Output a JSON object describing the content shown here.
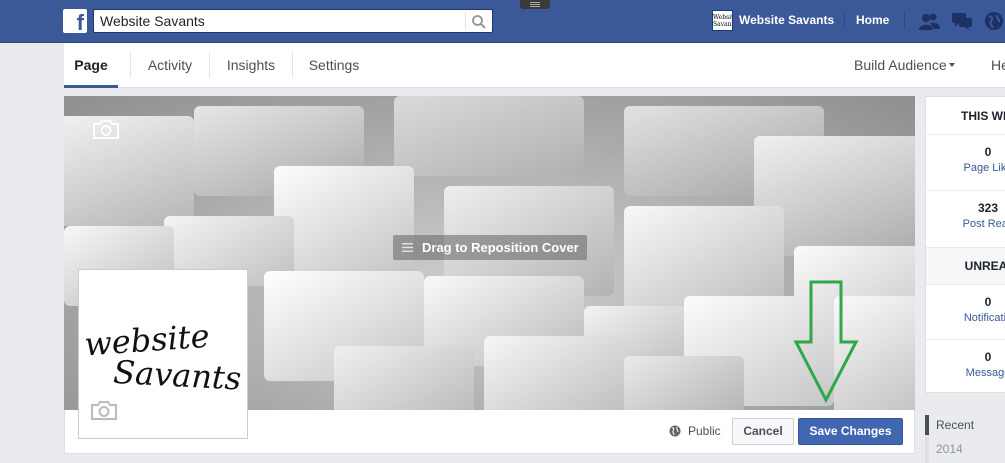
{
  "topbar": {
    "search_value": "Website Savants",
    "user_name": "Website Savants",
    "user_avatar_text": "Website Savants",
    "home_label": "Home"
  },
  "pagenav": {
    "tabs": [
      {
        "label": "Page",
        "active": true
      },
      {
        "label": "Activity",
        "active": false
      },
      {
        "label": "Insights",
        "active": false
      },
      {
        "label": "Settings",
        "active": false
      }
    ],
    "build_audience_label": "Build Audience",
    "help_label": "He"
  },
  "cover": {
    "reposition_label": "Drag to Reposition Cover",
    "privacy_label": "Public",
    "cancel_label": "Cancel",
    "save_label": "Save Changes"
  },
  "profile": {
    "logo_text_line1": "website",
    "logo_text_line2": "Savants"
  },
  "stats": {
    "this_week_header": "THIS WE",
    "this_week": [
      {
        "value": "0",
        "label": "Page Like"
      },
      {
        "value": "323",
        "label": "Post Reac"
      }
    ],
    "unread_header": "UNREA",
    "unread": [
      {
        "value": "0",
        "label": "Notificatio"
      },
      {
        "value": "0",
        "label": "Message"
      }
    ]
  },
  "timeline": {
    "recent_label": "Recent",
    "year_label": "2014"
  },
  "colors": {
    "brand_blue": "#3b5998",
    "save_button": "#4267b2",
    "annotation_arrow": "#2ea84a"
  }
}
